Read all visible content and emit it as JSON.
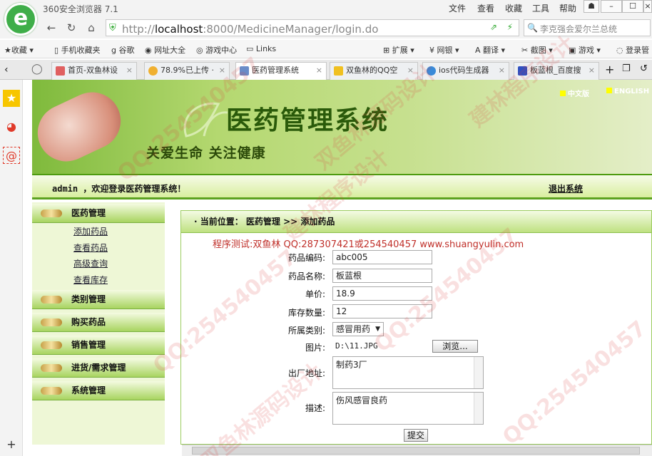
{
  "browser": {
    "title": "360安全浏览器 7.1",
    "menu": [
      "文件",
      "查看",
      "收藏",
      "工具",
      "帮助"
    ],
    "url_prefix": "http://",
    "url_host": "localhost",
    "url_rest": ":8000/MedicineManager/login.do",
    "search": "李克强会爱尔兰总统"
  },
  "bookmarks": [
    "收藏",
    "手机收藏夹",
    "谷歌",
    "网址大全",
    "游戏中心",
    "Links",
    "扩展",
    "网银",
    "翻译",
    "截图",
    "游戏",
    "登录管"
  ],
  "tabs": [
    "首页-双鱼林设",
    "78.9%已上传 ·",
    "医药管理系统",
    "双鱼林的QQ空",
    "ios代码生成器",
    "板蓝根_百度搜"
  ],
  "page": {
    "title": "医药管理系统",
    "slogan": "关爱生命  关注健康",
    "lang_cn": "中文版",
    "lang_en": "ENGLISH",
    "welcome": "admin ，欢迎登录医药管理系统！",
    "logout": "退出系统",
    "menu": [
      {
        "label": "医药管理",
        "sub": [
          "添加药品",
          "查看药品",
          "高级查询",
          "查看库存"
        ]
      },
      {
        "label": "类别管理"
      },
      {
        "label": "购买药品"
      },
      {
        "label": "销售管理"
      },
      {
        "label": "进货/需求管理"
      },
      {
        "label": "系统管理"
      }
    ],
    "breadcrumb": "· 当前位置： 医药管理 >> 添加药品",
    "notice": "程序测试:双鱼林 QQ:287307421或254540457 www.shuangyulin.com",
    "form": {
      "code_label": "药品编码:",
      "code": "abc005",
      "name_label": "药品名称:",
      "name": "板蓝根",
      "price_label": "单价:",
      "price": "18.9",
      "stock_label": "库存数量:",
      "stock": "12",
      "category_label": "所属类别:",
      "category": "感冒用药",
      "image_label": "图片:",
      "image": "D:\\11.JPG",
      "browse": "浏览...",
      "origin_label": "出厂地址:",
      "origin": "制药3厂",
      "desc_label": "描述:",
      "desc": "伤风感冒良药",
      "submit": "提交"
    }
  },
  "watermarks": [
    "QQ:254540457",
    "双鱼林源码设计",
    "建林程序设计"
  ]
}
